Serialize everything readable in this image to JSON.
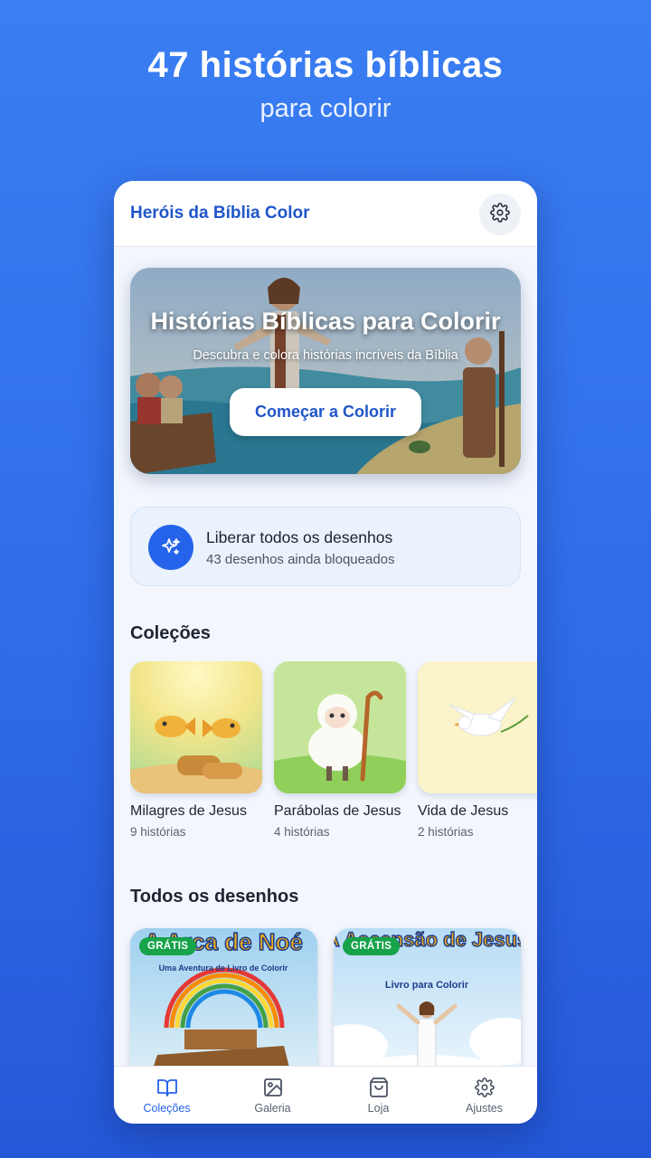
{
  "promo": {
    "title": "47 histórias bíblicas",
    "subtitle": "para colorir"
  },
  "app": {
    "title": "Heróis da Bíblia Color",
    "settings_icon": "gear-icon"
  },
  "hero": {
    "title": "Histórias Bíblicas para Colorir",
    "subtitle": "Descubra e colora histórias incríveis da Bíblia",
    "cta_label": "Começar a Colorir"
  },
  "unlock": {
    "icon": "sparkles-icon",
    "title": "Liberar todos os desenhos",
    "subtitle": "43 desenhos ainda bloqueados"
  },
  "collections": {
    "heading": "Coleções",
    "items": [
      {
        "name": "Milagres de Jesus",
        "count": "9 histórias"
      },
      {
        "name": "Parábolas de Jesus",
        "count": "4 histórias"
      },
      {
        "name": "Vida de Jesus",
        "count": "2 histórias"
      }
    ]
  },
  "drawings": {
    "heading": "Todos os desenhos",
    "items": [
      {
        "badge": "GRÁTIS",
        "title": "A Arca de Noé",
        "subtitle": "Uma Aventura de Livro de Colorir"
      },
      {
        "badge": "GRÁTIS",
        "title": "A Ascensão de Jesus",
        "subtitle": "Livro para Colorir"
      }
    ]
  },
  "nav": {
    "items": [
      {
        "label": "Coleções",
        "icon": "book-open-icon",
        "active": true
      },
      {
        "label": "Galeria",
        "icon": "image-icon",
        "active": false
      },
      {
        "label": "Loja",
        "icon": "shopping-bag-icon",
        "active": false
      },
      {
        "label": "Ajustes",
        "icon": "gear-icon",
        "active": false
      }
    ]
  },
  "colors": {
    "brand": "#1f55c9",
    "accent": "#2563eb",
    "badge": "#16a34a",
    "background": "#3a7ef2"
  }
}
